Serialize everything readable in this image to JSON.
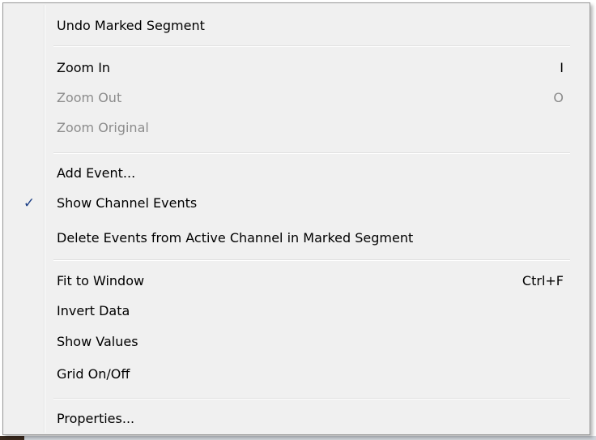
{
  "menu": {
    "items": [
      {
        "label": "Undo Marked Segment",
        "shortcut": "",
        "disabled": false,
        "checked": false
      },
      {
        "label": "Zoom In",
        "shortcut": "I",
        "disabled": false,
        "checked": false
      },
      {
        "label": "Zoom Out",
        "shortcut": "O",
        "disabled": true,
        "checked": false
      },
      {
        "label": "Zoom Original",
        "shortcut": "",
        "disabled": true,
        "checked": false
      },
      {
        "label": "Add Event...",
        "shortcut": "",
        "disabled": false,
        "checked": false
      },
      {
        "label": "Show Channel Events",
        "shortcut": "",
        "disabled": false,
        "checked": true
      },
      {
        "label": "Delete Events from Active Channel in Marked Segment",
        "shortcut": "",
        "disabled": false,
        "checked": false
      },
      {
        "label": "Fit to Window",
        "shortcut": "Ctrl+F",
        "disabled": false,
        "checked": false
      },
      {
        "label": "Invert Data",
        "shortcut": "",
        "disabled": false,
        "checked": false
      },
      {
        "label": "Show Values",
        "shortcut": "",
        "disabled": false,
        "checked": false
      },
      {
        "label": "Grid On/Off",
        "shortcut": "",
        "disabled": false,
        "checked": false
      },
      {
        "label": "Properties...",
        "shortcut": "",
        "disabled": false,
        "checked": false
      }
    ],
    "check_glyph": "✓",
    "check_color": "#1c3f86",
    "disabled_color": "#8c8c8c"
  }
}
